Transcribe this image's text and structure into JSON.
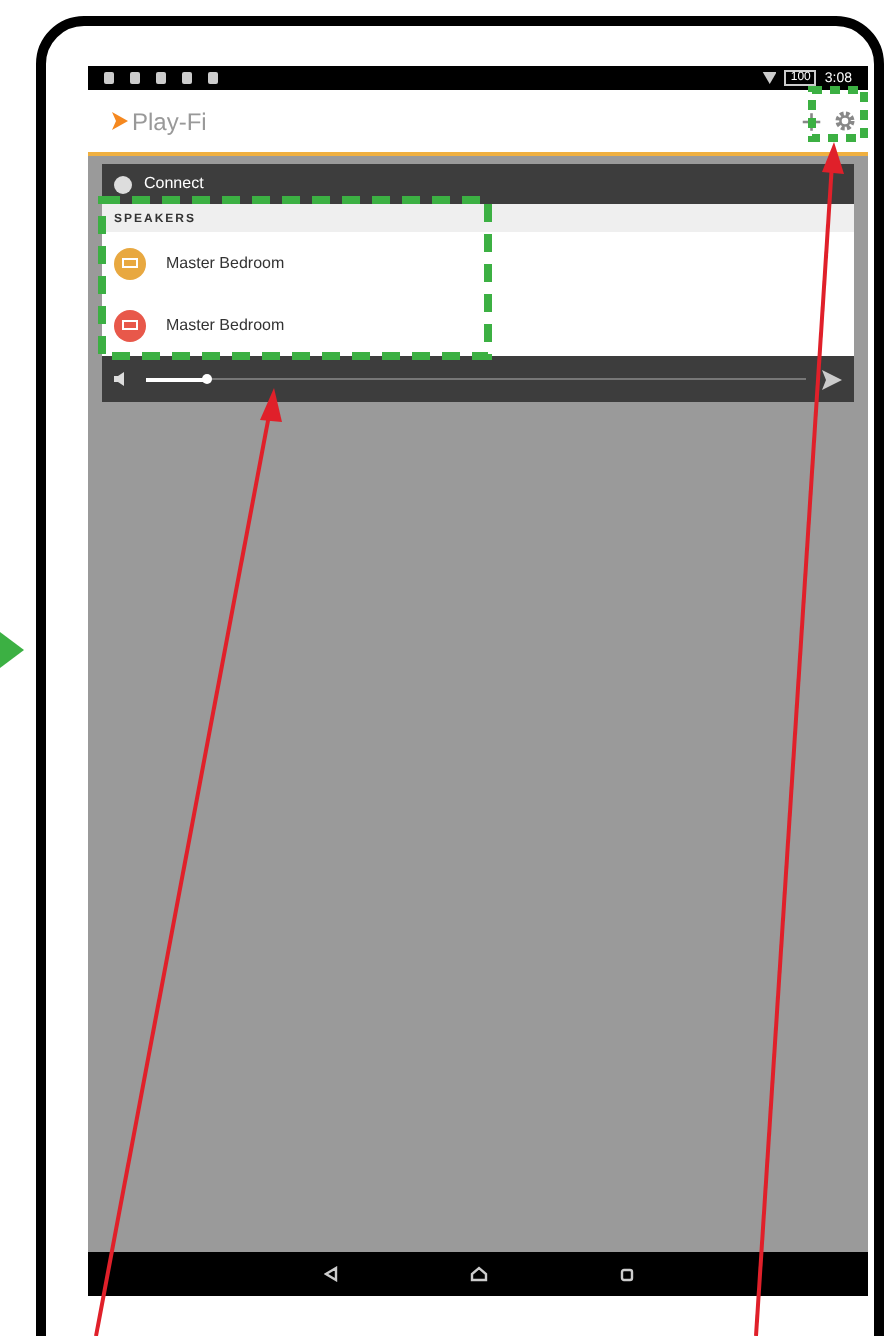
{
  "status_bar": {
    "time": "3:08",
    "battery": "100"
  },
  "app_bar": {
    "logo": "Play-Fi",
    "add": "+"
  },
  "connect": {
    "label": "Connect"
  },
  "speakers": {
    "header": "SPEAKERS",
    "items": [
      {
        "name": "Master Bedroom",
        "color": "#e8a840"
      },
      {
        "name": "Master Bedroom",
        "color": "#e8584a"
      }
    ]
  },
  "volume": {
    "level": 0.09
  }
}
